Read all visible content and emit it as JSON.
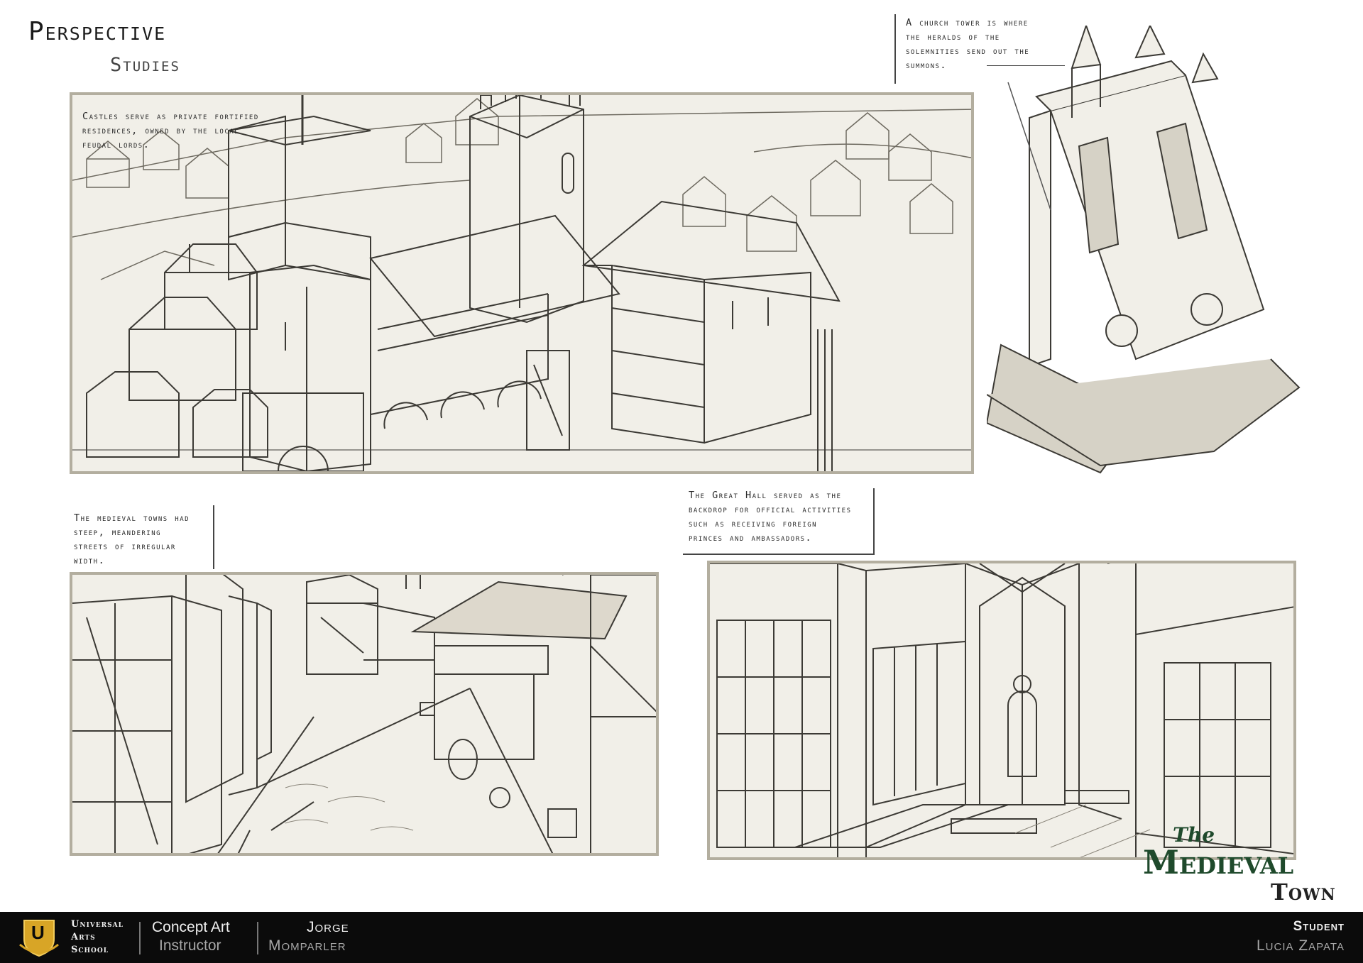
{
  "header": {
    "title_line1": "Perspective",
    "title_line2": "Studies"
  },
  "captions": {
    "castle": [
      "Castles serve as private fortified",
      "residences, owned by the local",
      "feudal lords."
    ],
    "church": [
      "A church tower is where",
      "the heralds of the",
      "solemnities send out the",
      "summons."
    ],
    "streets": [
      "The medieval towns had",
      "steep, meandering",
      "streets of irregular",
      "width."
    ],
    "hall": [
      "The Great Hall served as the",
      "backdrop for official activities",
      "such as receiving foreign",
      "princes and ambassadors."
    ]
  },
  "logo": {
    "line1": "The",
    "line2": "Medieval",
    "line3": "Town",
    "color": "#1f4a2c"
  },
  "footer": {
    "school_line1": "Universal",
    "school_line2": "Arts",
    "school_line3": "School",
    "badge_letter": "U",
    "course": "Concept Art",
    "course_role": "Instructor",
    "instructor_first": "Jorge",
    "instructor_last": "Momparler",
    "student_role": "Student",
    "student_name": "Lucia Zapata"
  },
  "colors": {
    "panel_bg": "#f1efe8",
    "panel_border": "#b3ae9f",
    "footer_bg": "#0b0b0b",
    "badge_gold": "#d8a526"
  }
}
